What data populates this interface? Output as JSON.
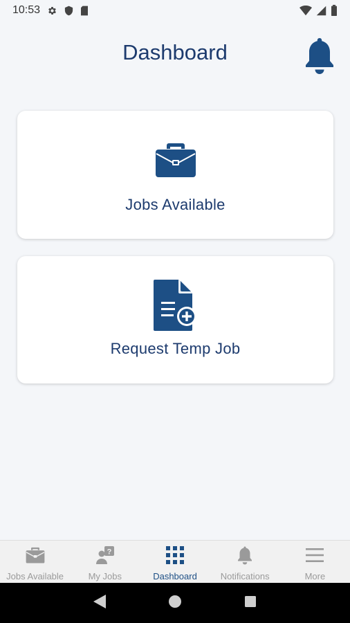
{
  "status_bar": {
    "time": "10:53",
    "left_icons": [
      "gear-icon",
      "shield-icon",
      "sd-card-icon"
    ],
    "right_icons": [
      "wifi-icon",
      "signal-icon",
      "battery-icon"
    ]
  },
  "header": {
    "title": "Dashboard",
    "notification_icon": "bell-icon"
  },
  "cards": [
    {
      "label": "Jobs Available",
      "icon": "briefcase-icon"
    },
    {
      "label": "Request Temp Job",
      "icon": "document-add-icon"
    }
  ],
  "bottom_nav": {
    "items": [
      {
        "label": "Jobs Available",
        "icon": "briefcase-icon",
        "active": false
      },
      {
        "label": "My Jobs",
        "icon": "person-question-icon",
        "active": false
      },
      {
        "label": "Dashboard",
        "icon": "grid-icon",
        "active": true
      },
      {
        "label": "Notifications",
        "icon": "bell-icon",
        "active": false
      },
      {
        "label": "More",
        "icon": "menu-icon",
        "active": false
      }
    ]
  },
  "system_nav": {
    "items": [
      "back-icon",
      "home-icon",
      "recents-icon"
    ]
  },
  "colors": {
    "primary": "#1d4f85",
    "title": "#1d3b6e",
    "background": "#f4f6f9",
    "nav_inactive": "#9a9a9a",
    "card": "#ffffff"
  }
}
